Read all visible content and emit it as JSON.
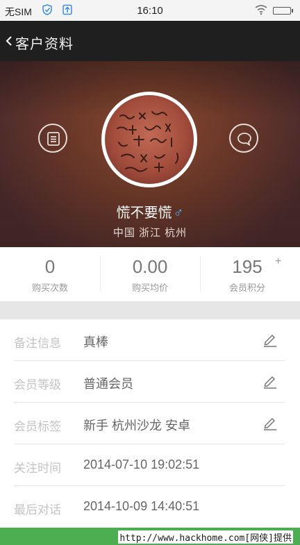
{
  "status_bar": {
    "carrier": "无SIM",
    "time": "16:10",
    "icons": [
      "shield-check-icon",
      "cloud-upload-icon",
      "wifi-icon",
      "battery-icon"
    ]
  },
  "header": {
    "back_icon": "chevron-left-icon",
    "title": "客户资料"
  },
  "profile": {
    "name": "慌不要慌",
    "gender_symbol": "♂",
    "location": "中国 浙江 杭州",
    "left_button_icon": "note-icon",
    "right_button_icon": "chat-bubble-icon"
  },
  "stats": [
    {
      "value": "0",
      "label": "购买次数"
    },
    {
      "value": "0.00",
      "label": "购买均价"
    },
    {
      "value": "195",
      "label": "会员积分"
    }
  ],
  "stats_plus": "+",
  "info_rows": [
    {
      "key": "备注信息",
      "value": "真棒",
      "editable": true
    },
    {
      "key": "会员等级",
      "value": "普通会员",
      "editable": true
    },
    {
      "key": "会员标签",
      "value": "新手 杭州沙龙 安卓",
      "editable": true
    },
    {
      "key": "关注时间",
      "value": "2014-07-10 19:02:51",
      "editable": false
    },
    {
      "key": "最后对话",
      "value": "2014-10-09 14:40:51",
      "editable": false
    }
  ],
  "watermark": "http://www.hackhome.com[网侠]提供",
  "colors": {
    "title_bar": "#1f1f1f",
    "banner": "#6e3a2a",
    "gender_accent": "#4fb4ff",
    "footer": "#4cae50"
  }
}
